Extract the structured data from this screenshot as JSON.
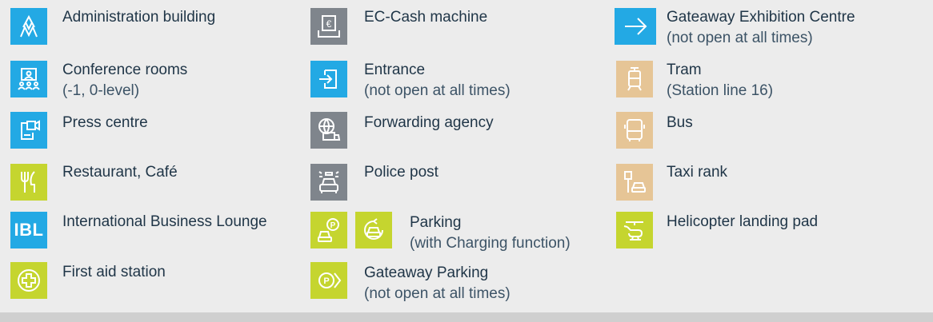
{
  "legend": {
    "col1": [
      {
        "label": "Administration building",
        "sub": "",
        "icon": "administration-building-icon",
        "color": "#23a9e4"
      },
      {
        "label": "Conference rooms",
        "sub": "(-1, 0-level)",
        "icon": "conference-rooms-icon",
        "color": "#23a9e4"
      },
      {
        "label": "Press centre",
        "sub": "",
        "icon": "press-centre-icon",
        "color": "#23a9e4"
      },
      {
        "label": "Restaurant, Café",
        "sub": "",
        "icon": "restaurant-icon",
        "color": "#c5d52f"
      },
      {
        "label": "International Business Lounge",
        "sub": "",
        "icon": "ibl-icon",
        "icon_text": "IBL",
        "color": "#23a9e4"
      },
      {
        "label": "First aid station",
        "sub": "",
        "icon": "first-aid-icon",
        "color": "#c5d52f"
      }
    ],
    "col2": [
      {
        "label": "EC-Cash machine",
        "sub": "",
        "icon": "ec-cash-icon",
        "color": "#7f858c"
      },
      {
        "label": "Entrance",
        "sub": "(not open at all times)",
        "icon": "entrance-icon",
        "color": "#23a9e4"
      },
      {
        "label": "Forwarding agency",
        "sub": "",
        "icon": "forwarding-agency-icon",
        "color": "#7f858c"
      },
      {
        "label": "Police post",
        "sub": "",
        "icon": "police-post-icon",
        "color": "#7f858c"
      },
      {
        "label": "Parking",
        "sub": "(with Charging function)",
        "icon": "parking-icon",
        "color": "#c5d52f"
      },
      {
        "label": "Gateaway Parking",
        "sub": "(not open at all times)",
        "icon": "gateaway-parking-icon",
        "color": "#c5d52f"
      }
    ],
    "col3": [
      {
        "label": "Gateaway Exhibition Centre",
        "sub": "(not open at all times)",
        "icon": "arrow-right-icon",
        "color": "#23a9e4"
      },
      {
        "label": "Tram",
        "sub": "(Station line 16)",
        "icon": "tram-icon",
        "color": "#e6c596"
      },
      {
        "label": "Bus",
        "sub": "",
        "icon": "bus-icon",
        "color": "#e6c596"
      },
      {
        "label": "Taxi rank",
        "sub": "",
        "icon": "taxi-icon",
        "color": "#e6c596"
      },
      {
        "label": "Helicopter landing pad",
        "sub": "",
        "icon": "helicopter-icon",
        "color": "#c5d52f"
      }
    ]
  }
}
